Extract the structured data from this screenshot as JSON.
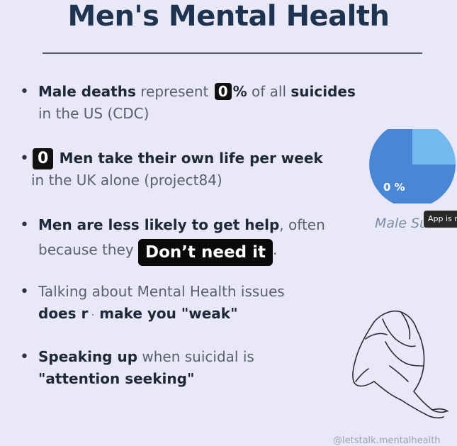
{
  "title": "Men's Mental Health",
  "bullets": {
    "b1": {
      "bold1": "Male deaths",
      "text1": " represent ",
      "chip": "0",
      "pct": "%",
      "text2": " of all ",
      "bold2": "suicides",
      "line2": "in the US (CDC)"
    },
    "b2": {
      "chip": "0",
      "bold1": "Men take their own life per week",
      "line2": "in the UK alone (project84)"
    },
    "b3": {
      "bold1": "Men are less likely to get help",
      "text1": ", often",
      "line2": "because they",
      "chip": "Don’t need it",
      "tail": "."
    },
    "b4": {
      "line1": "Talking about Mental Health issues",
      "bold1": "does r",
      "bold2": " make you \"weak\""
    },
    "b5": {
      "bold1": "Speaking up",
      "text1": " when suicidal is",
      "bold2": "\"attention seeking\""
    }
  },
  "pie": {
    "value_label": "0 %",
    "caption": "Male Su",
    "colors": {
      "main": "#4a86d6",
      "slice": "#74b9ee"
    },
    "slice_fraction": 0.25
  },
  "toast": {
    "text": "App is r"
  },
  "handle": "@letstalk.mentalhealth",
  "icons": {
    "figure": "sad-sitting-man-icon"
  }
}
